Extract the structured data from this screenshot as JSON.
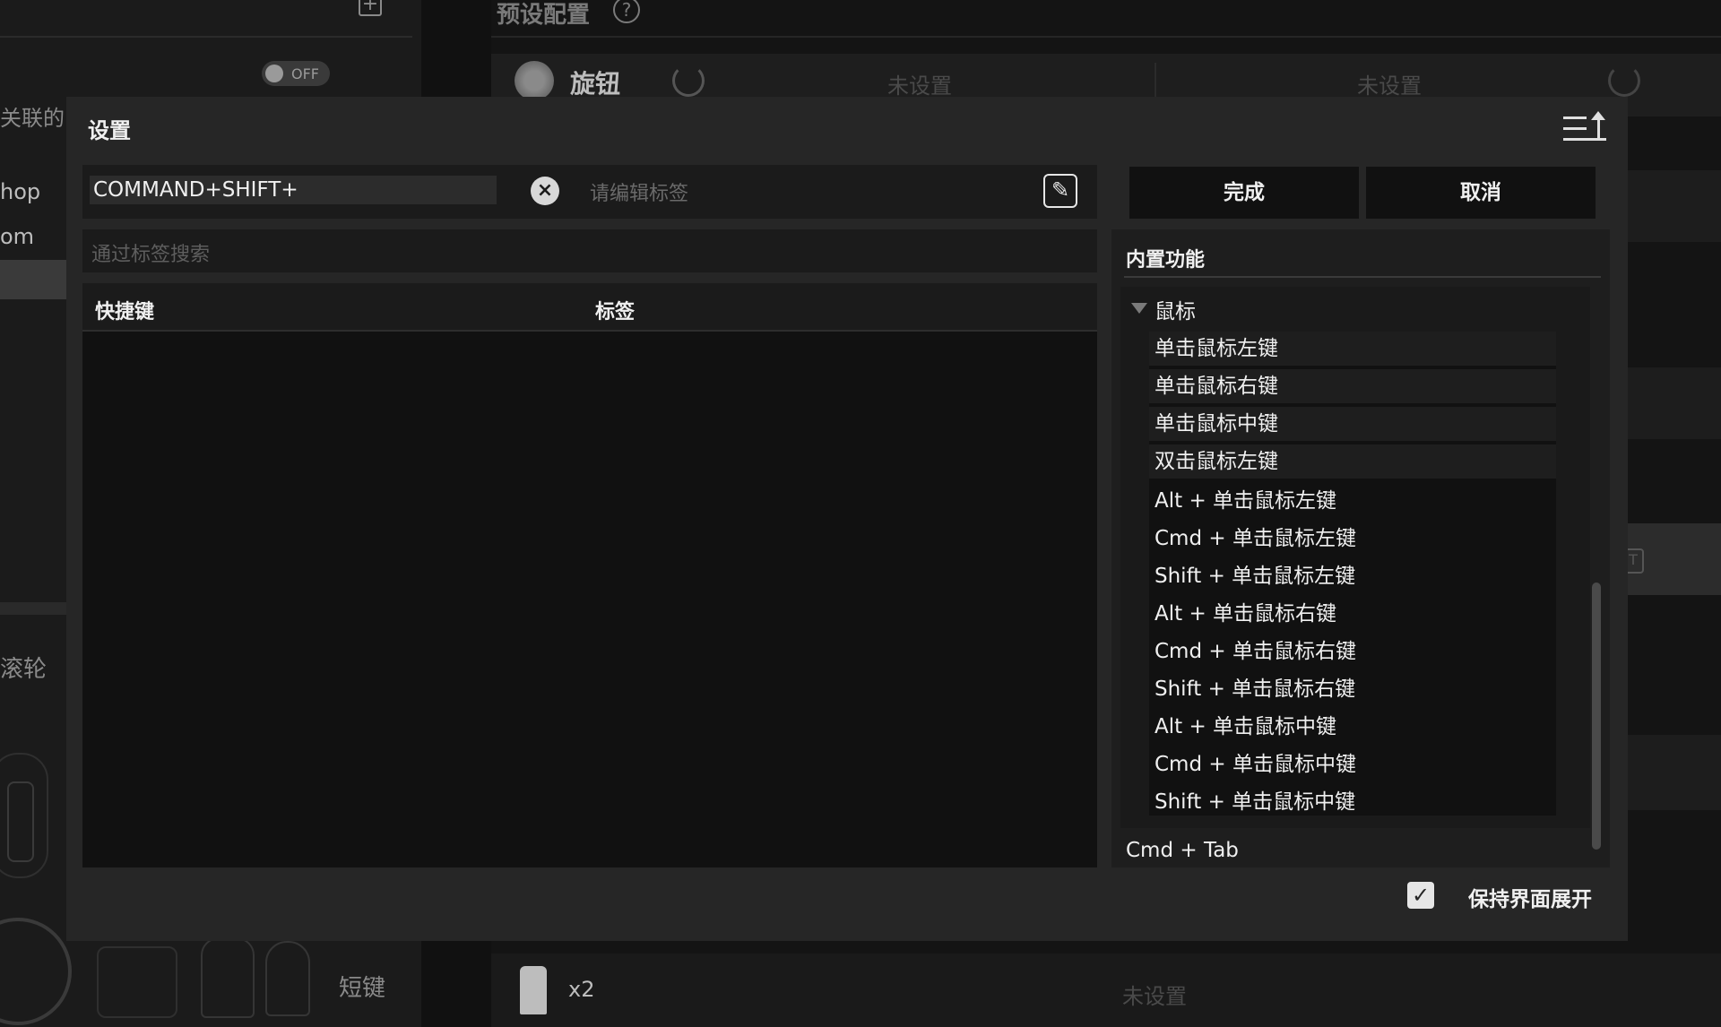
{
  "background": {
    "toggle_label": "OFF",
    "associated_label": "关联的",
    "app_items": [
      "hop",
      "om"
    ],
    "wheel_label": "滚轮",
    "short_key_label": "短键",
    "preset_title": "预设配置",
    "help_glyph": "?",
    "knob_label": "旋钮",
    "unset_left": "未设置",
    "unset_right": "未设置",
    "bottom_count": "x2",
    "bottom_unset": "未设置",
    "t_glyph": "T"
  },
  "modal": {
    "title": "设置",
    "shortcut_value": "COMMAND+SHIFT+",
    "tag_placeholder": "请编辑标签",
    "search_placeholder": "通过标签搜索",
    "columns": {
      "shortcut": "快捷键",
      "tag": "标签"
    },
    "done_label": "完成",
    "cancel_label": "取消",
    "builtin_title": "内置功能",
    "group_mouse": "鼠标",
    "mouse_items": [
      "单击鼠标左键",
      "单击鼠标右键",
      "单击鼠标中键",
      "双击鼠标左键",
      "Alt + 单击鼠标左键",
      "Cmd + 单击鼠标左键",
      "Shift + 单击鼠标左键",
      "Alt + 单击鼠标右键",
      "Cmd + 单击鼠标右键",
      "Shift + 单击鼠标右键",
      "Alt + 单击鼠标中键",
      "Cmd + 单击鼠标中键",
      "Shift + 单击鼠标中键"
    ],
    "next_group": "Cmd + Tab",
    "keep_expanded_label": "保持界面展开",
    "keep_expanded_checked": true
  },
  "colors": {
    "modal_bg": "#262626",
    "panel_bg": "#111111",
    "text": "#f0f0f0",
    "muted": "#6a6a6a"
  }
}
